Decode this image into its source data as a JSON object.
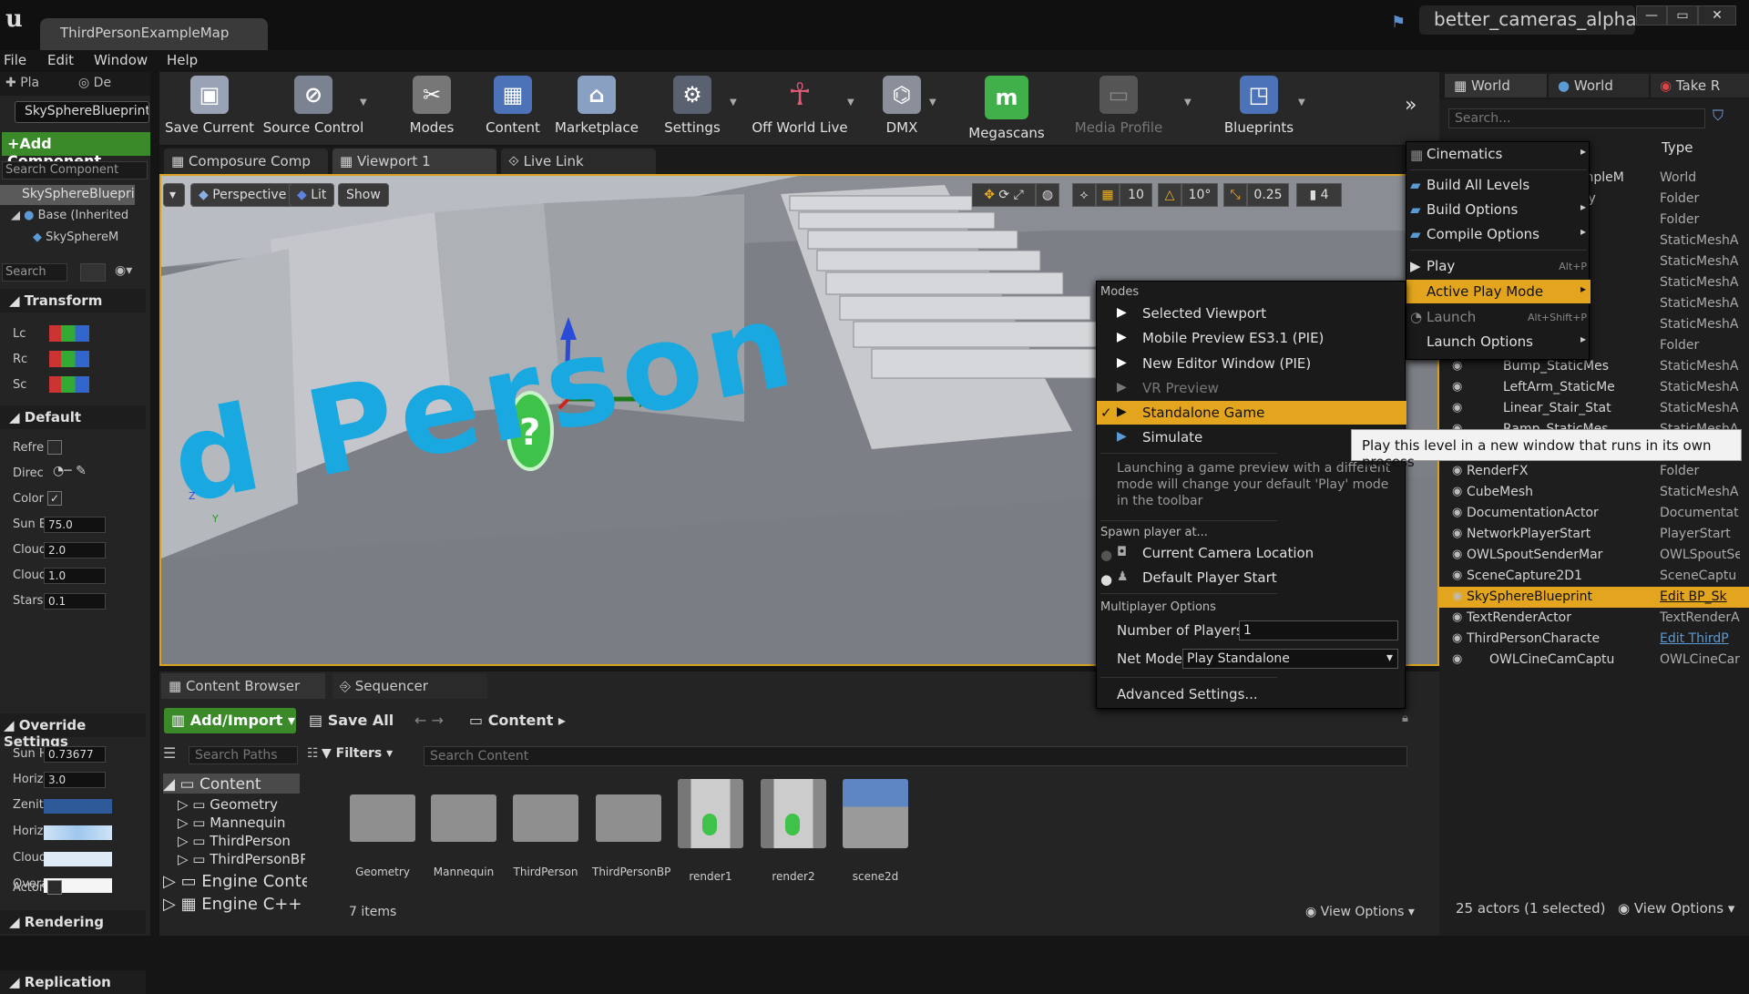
{
  "titlebar": {
    "map_tab": "ThirdPersonExampleMap",
    "project_name": "better_cameras_alpha",
    "window_buttons": [
      "—",
      "▭",
      "✕"
    ]
  },
  "menubar": [
    "File",
    "Edit",
    "Window",
    "Help"
  ],
  "left_panel": {
    "tabs": [
      "Pla",
      "De"
    ],
    "blueprint_button": "SkySphereBlueprint",
    "add_component": "+Add Component",
    "search_component_placeholder": "Search Component",
    "component_root": "SkySphereBlueprint",
    "component_base": "Base (Inherited",
    "component_mesh": "SkySphereM",
    "search_details_placeholder": "Search",
    "sections": {
      "transform": "Transform",
      "default": "Default",
      "override": "Override Settings",
      "rendering": "Rendering",
      "replication": "Replication"
    },
    "transform_rows": [
      "Lc",
      "Rc",
      "Sc"
    ],
    "default_rows": [
      {
        "label": "Refre",
        "value": ""
      },
      {
        "label": "Direc",
        "value": ""
      },
      {
        "label": "Color",
        "value": "✓"
      },
      {
        "label": "Sun B",
        "value": "75.0"
      },
      {
        "label": "Cloud",
        "value": "2.0"
      },
      {
        "label": "Cloud",
        "value": "1.0"
      },
      {
        "label": "Stars",
        "value": "0.1"
      }
    ],
    "override_rows": [
      {
        "label": "Sun H",
        "value": "0.73677"
      },
      {
        "label": "Horiz",
        "value": "3.0"
      },
      {
        "label": "Zenit",
        "value": ""
      },
      {
        "label": "Horiz",
        "value": ""
      },
      {
        "label": "Cloud",
        "value": ""
      },
      {
        "label": "Overa",
        "value": ""
      }
    ],
    "rendering_row": "Actor"
  },
  "toolbar": {
    "buttons": [
      {
        "label": "Save Current",
        "icon": "save-icon"
      },
      {
        "label": "Source Control",
        "icon": "source-control-icon"
      },
      {
        "label": "Modes",
        "icon": "modes-icon"
      },
      {
        "label": "Content",
        "icon": "content-icon"
      },
      {
        "label": "Marketplace",
        "icon": "marketplace-icon"
      },
      {
        "label": "Settings",
        "icon": "settings-icon"
      },
      {
        "label": "Off World Live",
        "icon": "off-world-live-icon"
      },
      {
        "label": "DMX",
        "icon": "dmx-icon"
      },
      {
        "label": "Megascans",
        "icon": "megascans-icon"
      },
      {
        "label": "Media Profile",
        "icon": "media-profile-icon"
      },
      {
        "label": "Blueprints",
        "icon": "blueprints-icon"
      }
    ]
  },
  "viewport_tabs": [
    "Composure Comp",
    "Viewport 1",
    "Live Link"
  ],
  "viewport": {
    "perspective": "Perspective",
    "lit": "Lit",
    "show": "Show",
    "grid_snap": "10",
    "rot_snap": "10°",
    "scale_snap": "0.25",
    "cam_speed": "4",
    "floor_text": "d Person",
    "axis_z": "Z",
    "axis_y": "Y"
  },
  "content_browser": {
    "tabs": [
      "Content Browser",
      "Sequencer"
    ],
    "add_import": "Add/Import",
    "save_all": "Save All",
    "path": "Content",
    "search_paths_placeholder": "Search Paths",
    "filters": "Filters",
    "search_content_placeholder": "Search Content",
    "tree": [
      "Content",
      "Geometry",
      "Mannequin",
      "ThirdPerson",
      "ThirdPersonBP",
      "Engine Conter",
      "Engine C++ Cl"
    ],
    "assets": [
      "Geometry",
      "Mannequin",
      "ThirdPerson",
      "ThirdPersonBP",
      "render1",
      "render2",
      "scene2d"
    ],
    "item_count": "7 items",
    "view_options": "View Options"
  },
  "right_panel": {
    "tabs": [
      "World",
      "World",
      "Take R"
    ],
    "search_placeholder": "Search...",
    "type_header": "Type",
    "rows": [
      {
        "name": "ExampleM",
        "type": "World"
      },
      {
        "name": "metry",
        "type": "Folder"
      },
      {
        "name": "",
        "type": "Folder"
      },
      {
        "name": "",
        "type": "StaticMeshA"
      },
      {
        "name": "",
        "type": "StaticMeshA"
      },
      {
        "name": "",
        "type": "StaticMeshA"
      },
      {
        "name": "",
        "type": "StaticMeshA"
      },
      {
        "name": "",
        "type": "StaticMeshA"
      },
      {
        "name": "",
        "type": "Folder"
      },
      {
        "name": "Bump_StaticMes",
        "type": "StaticMeshA"
      },
      {
        "name": "LeftArm_StaticMe",
        "type": "StaticMeshA"
      },
      {
        "name": "Linear_Stair_Stat",
        "type": "StaticMeshA"
      },
      {
        "name": "Ramp_StaticMes",
        "type": "StaticMeshA"
      },
      {
        "name": "Lighting",
        "type": "Folder"
      },
      {
        "name": "RenderFX",
        "type": "Folder"
      },
      {
        "name": "CubeMesh",
        "type": "StaticMeshA"
      },
      {
        "name": "DocumentationActor",
        "type": "Documentat"
      },
      {
        "name": "NetworkPlayerStart",
        "type": "PlayerStart"
      },
      {
        "name": "OWLSpoutSenderMar",
        "type": "OWLSpoutSe"
      },
      {
        "name": "SceneCapture2D1",
        "type": "SceneCaptu"
      },
      {
        "name": "SkySphereBlueprint",
        "type": "Edit BP_Sk"
      },
      {
        "name": "TextRenderActor",
        "type": "TextRenderA"
      },
      {
        "name": "ThirdPersonCharacte",
        "type": "Edit ThirdP"
      },
      {
        "name": "OWLCineCamCaptu",
        "type": "OWLCineCar"
      }
    ],
    "actor_count": "25 actors (1 selected)",
    "view_options": "View Options"
  },
  "play_menu": {
    "items": [
      {
        "label": "Cinematics",
        "shortcut": "",
        "arrow": "▸"
      },
      {
        "label": "Build All Levels",
        "shortcut": "",
        "arrow": ""
      },
      {
        "label": "Build Options",
        "shortcut": "",
        "arrow": "▸"
      },
      {
        "label": "Compile Options",
        "shortcut": "",
        "arrow": "▸"
      },
      {
        "label": "Play",
        "shortcut": "Alt+P",
        "arrow": ""
      },
      {
        "label": "Active Play Mode",
        "shortcut": "",
        "arrow": "▸"
      },
      {
        "label": "Launch",
        "shortcut": "Alt+Shift+P",
        "arrow": ""
      },
      {
        "label": "Launch Options",
        "shortcut": "",
        "arrow": "▸"
      }
    ]
  },
  "modes_menu": {
    "header": "Modes",
    "modes": [
      "Selected Viewport",
      "Mobile Preview ES3.1 (PIE)",
      "New Editor Window (PIE)",
      "VR Preview",
      "Standalone Game",
      "Simulate"
    ],
    "note": "Launching a game preview with a different mode will change your default 'Play' mode in the toolbar",
    "spawn_header": "Spawn player at...",
    "spawn_options": [
      "Current Camera Location",
      "Default Player Start"
    ],
    "multiplayer_header": "Multiplayer Options",
    "num_players_label": "Number of Players",
    "num_players_value": "1",
    "net_mode_label": "Net Mode",
    "net_mode_value": "Play Standalone",
    "advanced": "Advanced Settings..."
  },
  "tooltip": "Play this level in a new window that runs in its own process",
  "colors": {
    "accent": "#f0b020",
    "green": "#3a8a2a",
    "selection": "#e2a51d",
    "link": "#5b9bd5"
  }
}
